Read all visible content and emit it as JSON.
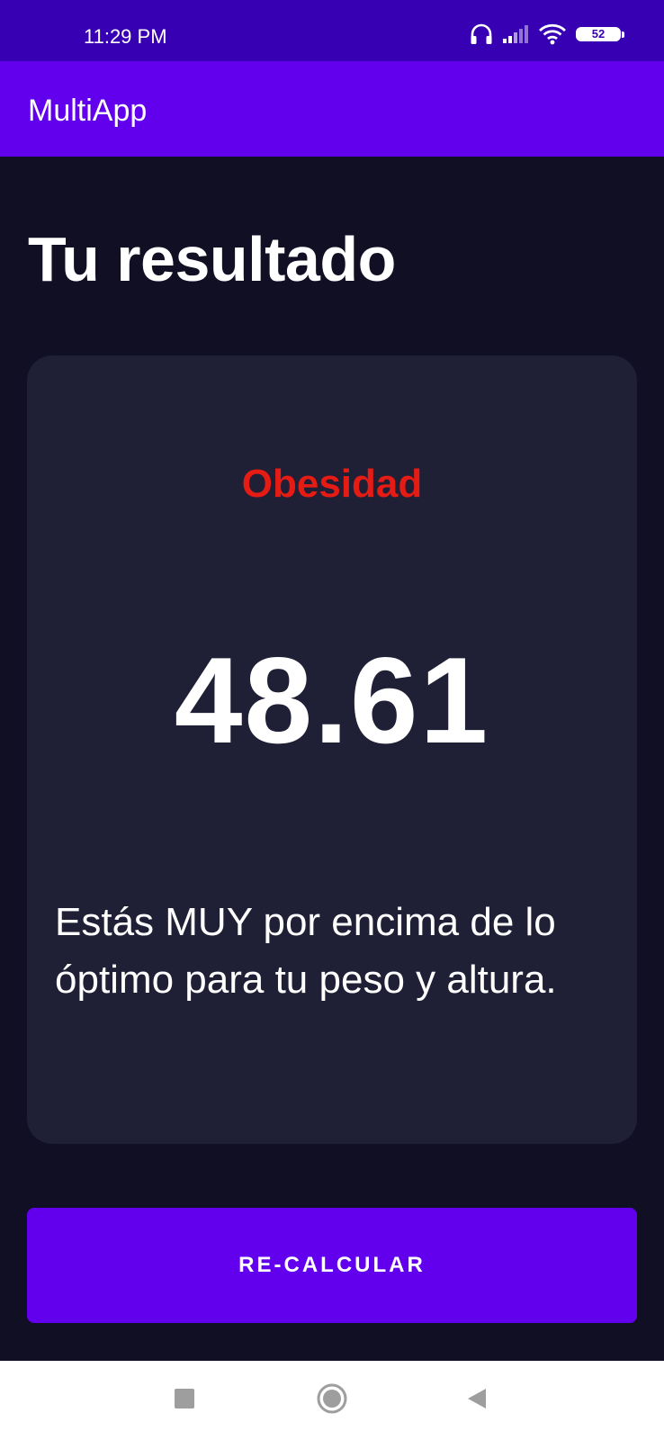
{
  "status_bar": {
    "time": "11:29 PM",
    "battery_level": "52",
    "icons": [
      "headset-icon",
      "signal-icon",
      "wifi-icon",
      "battery-icon"
    ]
  },
  "app_bar": {
    "title": "MultiApp"
  },
  "page": {
    "title": "Tu resultado"
  },
  "result": {
    "status": "Obesidad",
    "value": "48.61",
    "message": "Estás MUY por encima de lo óptimo para tu peso y altura."
  },
  "actions": {
    "recalculate_label": "RE-CALCULAR"
  },
  "nav_bar": {
    "icons": [
      "recents-icon",
      "home-icon",
      "back-icon"
    ]
  },
  "colors": {
    "status_bar": "#3700b3",
    "app_bar": "#6200ee",
    "background": "#100f24",
    "card": "#1f1f35",
    "status_text": "#e51b14",
    "button": "#6200ee"
  }
}
